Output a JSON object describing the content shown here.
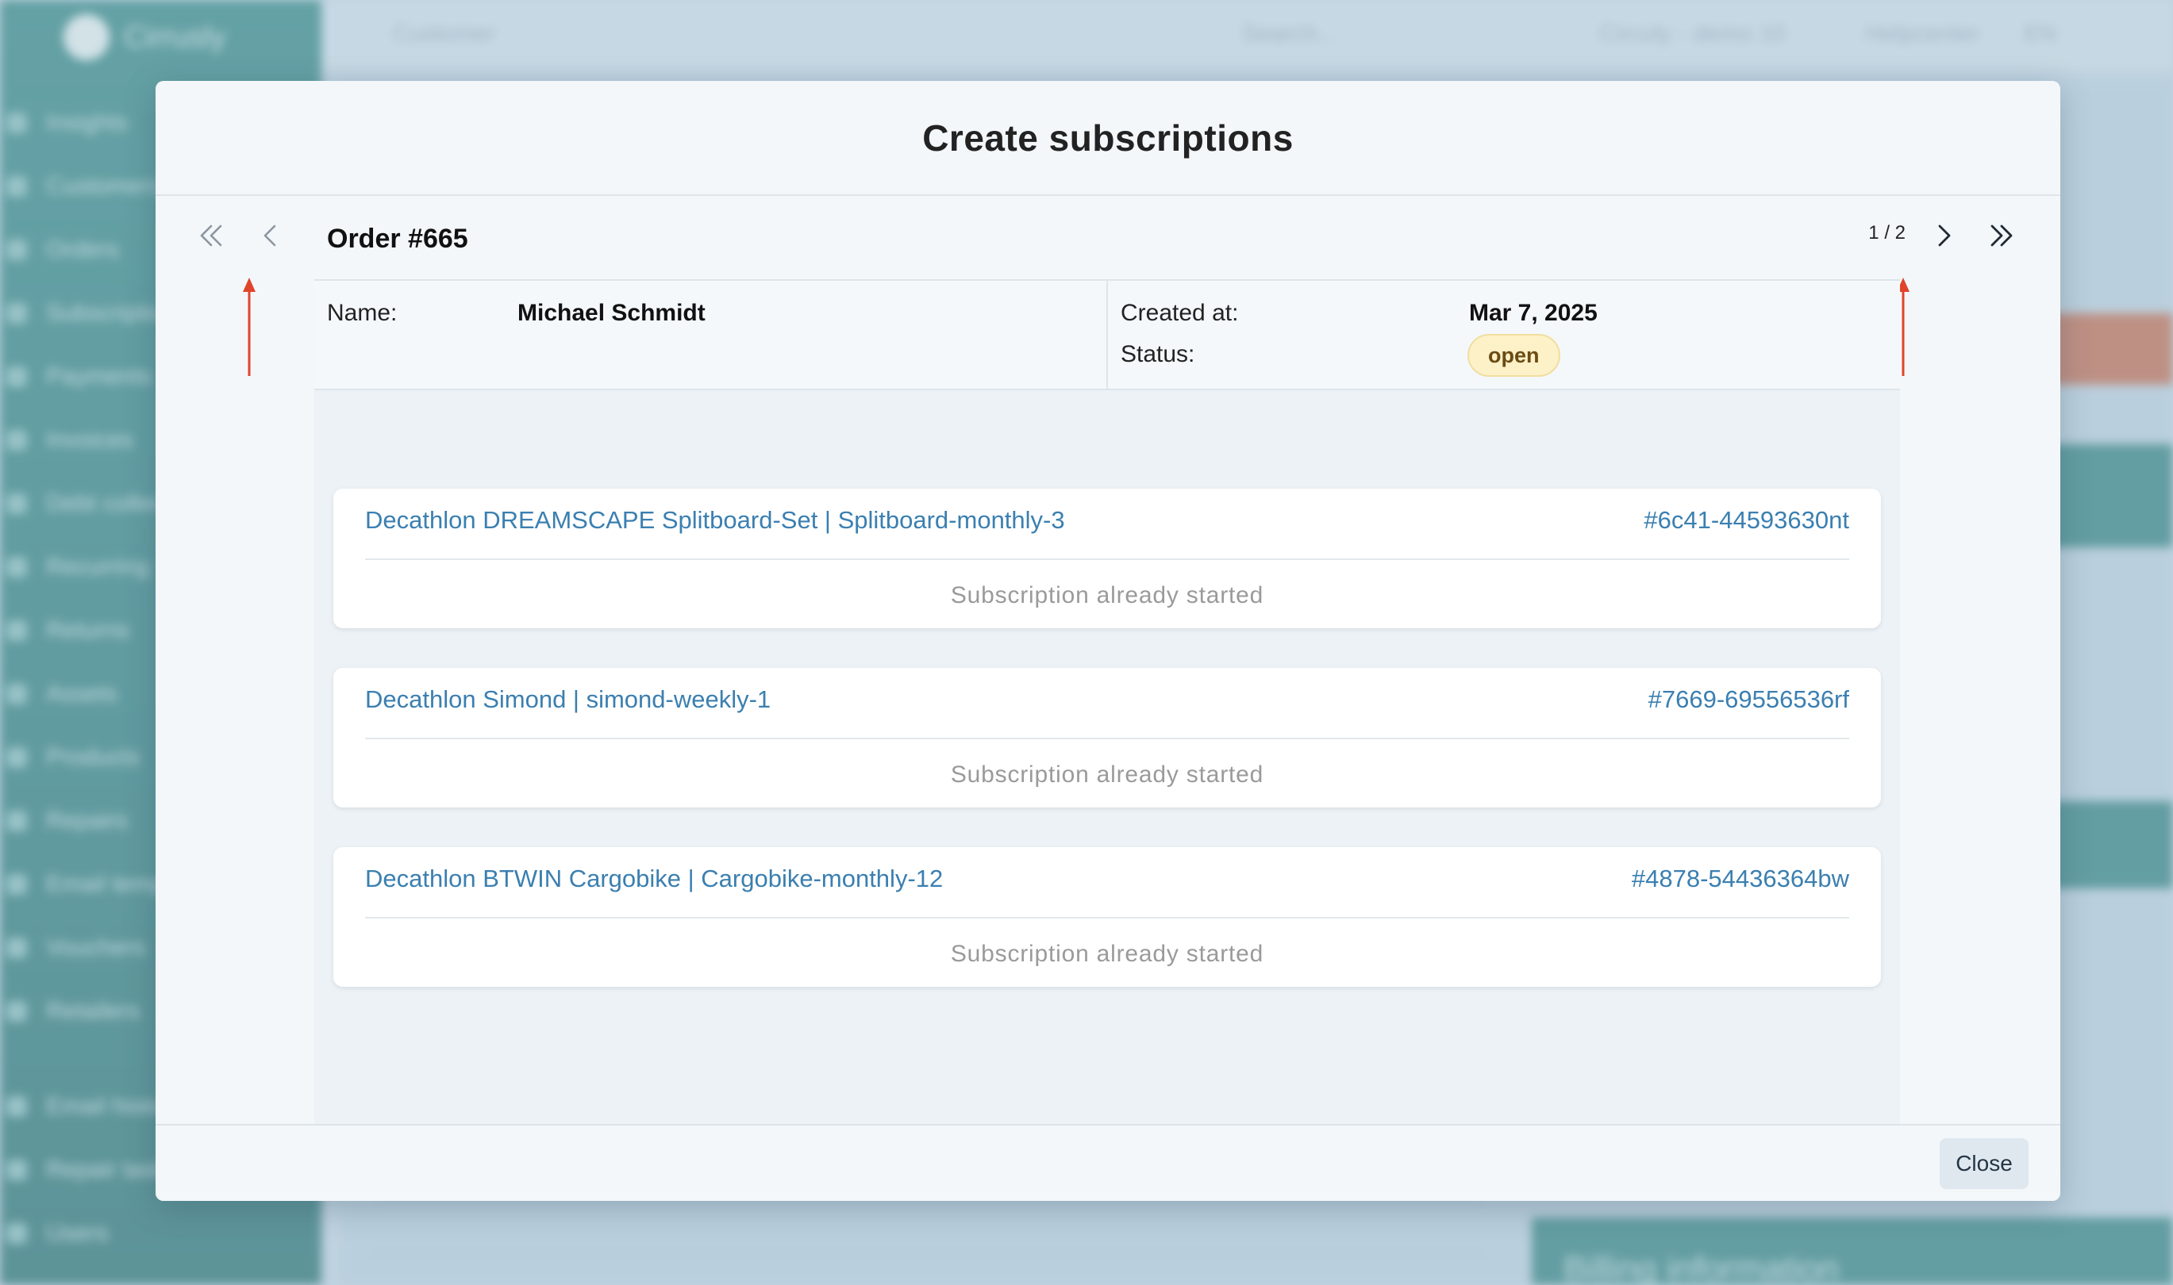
{
  "background": {
    "brand": "Cirrusly",
    "nav_items": [
      "Insights",
      "Customers",
      "Orders",
      "Subscriptions",
      "Payments",
      "Invoices",
      "Debt collection",
      "Recurring",
      "Returns",
      "Assets",
      "Products",
      "Repairs",
      "Email templates",
      "Vouchers",
      "Retailers",
      "Email history",
      "Repair tasks",
      "Users"
    ],
    "header": {
      "breadcrumb": "Customer",
      "search_placeholder": "Search...",
      "org": "Circuly - demo 10",
      "help": "Helpcenter",
      "lang": "EN"
    },
    "billing": "Billing information"
  },
  "modal": {
    "title": "Create subscriptions",
    "order_title": "Order #665",
    "pager": "1 / 2",
    "name_label": "Name:",
    "name_value": "Michael Schmidt",
    "created_label": "Created at:",
    "created_value": "Mar 7, 2025",
    "status_label": "Status:",
    "status_value": "open",
    "items": [
      {
        "name": "Decathlon DREAMSCAPE Splitboard-Set | Splitboard-monthly-3",
        "id": "#6c41-44593630nt",
        "status": "Subscription already started"
      },
      {
        "name": "Decathlon Simond | simond-weekly-1",
        "id": "#7669-69556536rf",
        "status": "Subscription already started"
      },
      {
        "name": "Decathlon BTWIN Cargobike | Cargobike-monthly-12",
        "id": "#4878-54436364bw",
        "status": "Subscription already started"
      }
    ],
    "close_label": "Close"
  },
  "colors": {
    "accent_link": "#3b7fb0",
    "annotation_arrow": "#e0442b",
    "badge_bg": "#fdf1c8",
    "sidebar": "#3f8f8c"
  }
}
